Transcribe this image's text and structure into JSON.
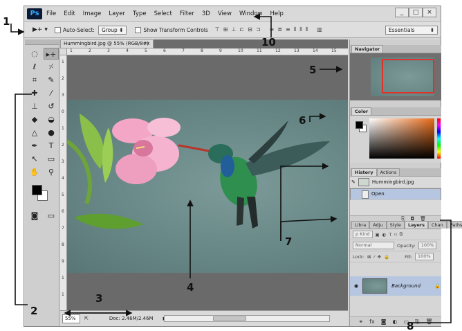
{
  "app": {
    "logo": "Ps",
    "menu": [
      "File",
      "Edit",
      "Image",
      "Layer",
      "Type",
      "Select",
      "Filter",
      "3D",
      "View",
      "Window",
      "Help"
    ],
    "window_controls": [
      "_",
      "□",
      "×"
    ]
  },
  "options_bar": {
    "tool_preset": "▶+ ▾",
    "auto_select_label": "Auto-Select:",
    "auto_select_value": "Group",
    "show_transform_label": "Show Transform Controls",
    "workspace": "Essentials"
  },
  "document": {
    "tab_title": "Hummingbird.jpg @ 55% (RGB/8#)",
    "tab_close": "×",
    "ruler_top_ticks": [
      "1",
      "2",
      "3",
      "4",
      "5",
      "6",
      "7",
      "8",
      "9",
      "10",
      "11",
      "12",
      "13",
      "14",
      "15"
    ],
    "ruler_left_ticks": [
      "1",
      "2",
      "3",
      "0",
      "1",
      "2",
      "3",
      "4",
      "5",
      "6",
      "7",
      "8",
      "9",
      "1",
      "1"
    ],
    "zoom": "55%",
    "doc_size": "Doc: 2.46M/2.46M"
  },
  "panels": {
    "navigator": {
      "tab": "Navigator"
    },
    "color": {
      "tab": "Color",
      "fg": "#000000",
      "bg": "#ffffff"
    },
    "history": {
      "tabs": [
        "History",
        "Actions"
      ],
      "items": [
        "Hummingbird.jpg",
        "Open"
      ]
    },
    "layers": {
      "tabs": [
        "Libra",
        "Adju",
        "Style",
        "Layers",
        "Chan",
        "Paths"
      ],
      "kind_label": "ρ Kind",
      "blend_mode": "Normal",
      "opacity_label": "Opacity:",
      "opacity_value": "100%",
      "lock_label": "Lock:",
      "fill_label": "Fill:",
      "fill_value": "100%",
      "layer_name": "Background"
    }
  },
  "annotations": [
    "1",
    "2",
    "3",
    "4",
    "5",
    "6",
    "7",
    "8",
    "10"
  ]
}
